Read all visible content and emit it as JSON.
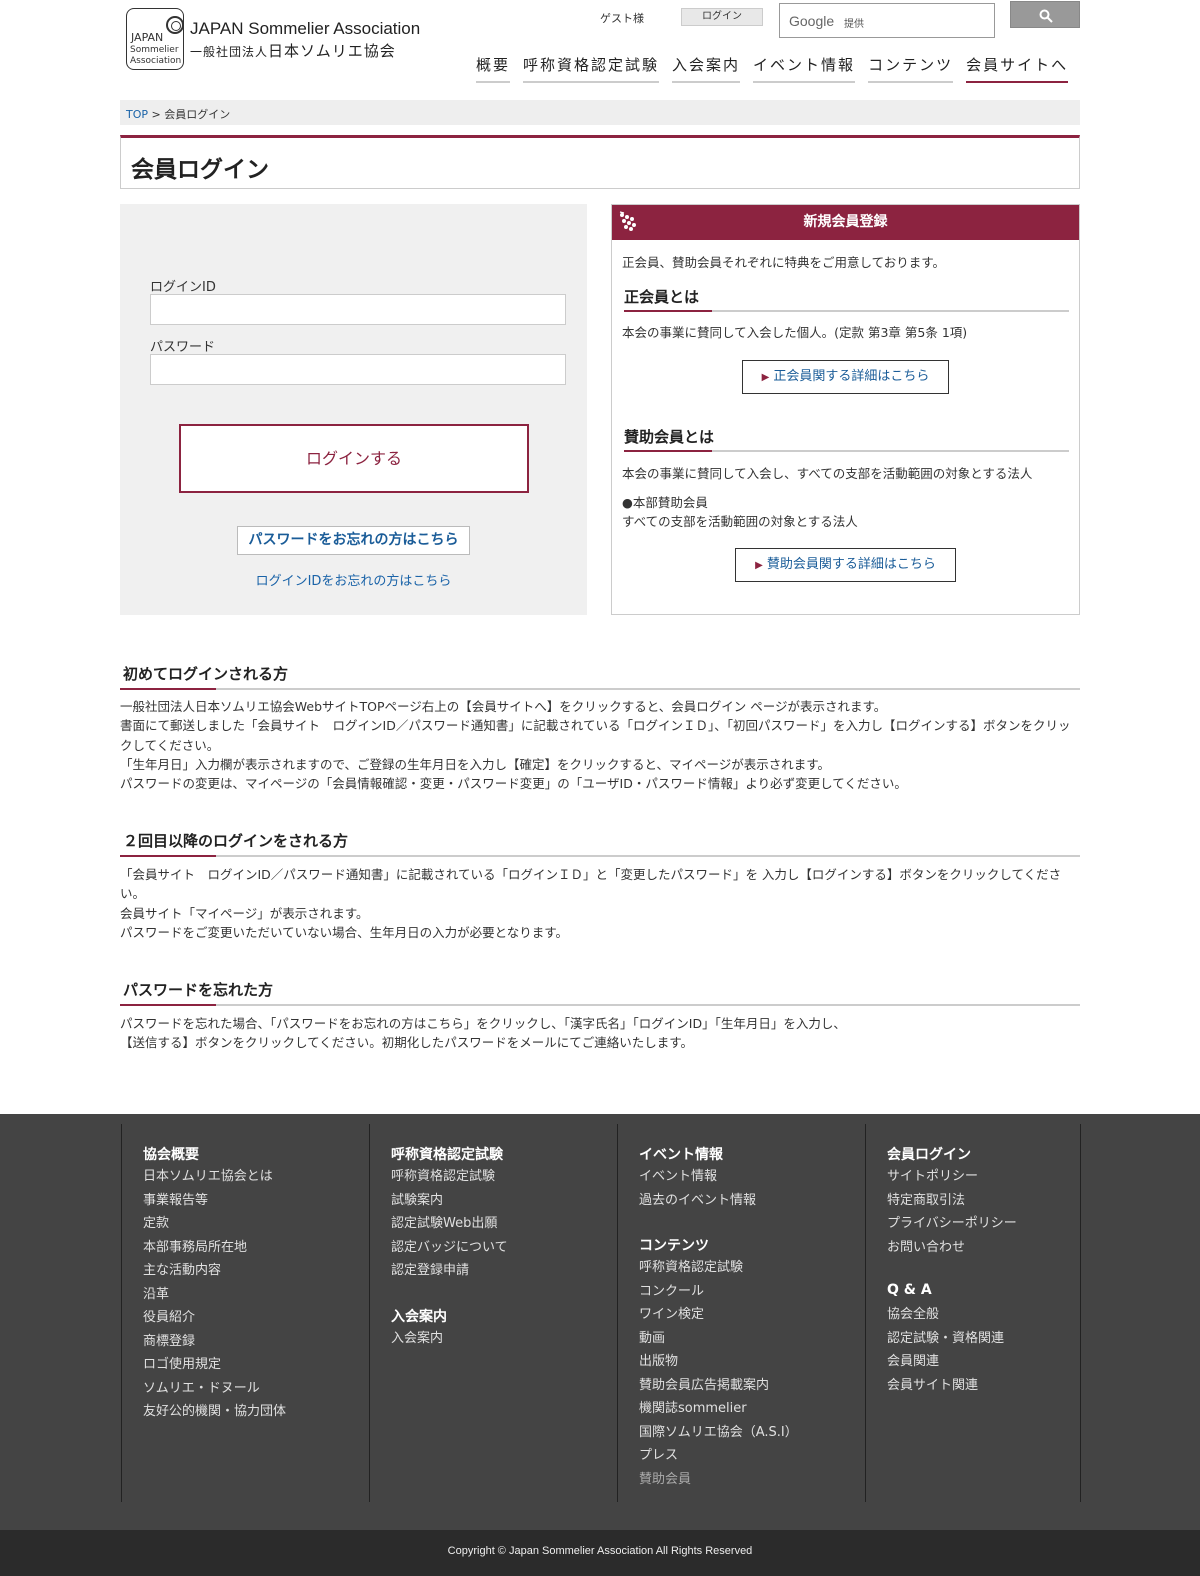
{
  "header": {
    "logo_badge_line1": "JAPAN",
    "logo_badge_line2": "Sommelier",
    "logo_badge_line3": "Association",
    "logo_en": "JAPAN Sommelier Association",
    "logo_jp_prefix": "一般社団法人",
    "logo_jp_name": "日本ソムリエ協会",
    "guest": "ゲスト様",
    "login_label": "ログイン",
    "search_brand": "Google",
    "search_provided": "提供",
    "nav": [
      "概要",
      "呼称資格認定試験",
      "入会案内",
      "イベント情報",
      "コンテンツ",
      "会員サイトへ"
    ]
  },
  "breadcrumb": {
    "top": "TOP",
    "sep": " > ",
    "current": "会員ログイン"
  },
  "page_title": "会員ログイン",
  "login": {
    "id_label": "ログインID",
    "password_label": "パスワード",
    "submit": "ログインする",
    "forgot_password": "パスワードをお忘れの方はこちら",
    "forgot_id": "ログインIDをお忘れの方はこちら"
  },
  "register": {
    "title": "新規会員登録",
    "intro": "正会員、賛助会員それぞれに特典をご用意しております。",
    "regular_heading": "正会員とは",
    "regular_text": "本会の事業に賛同して入会した個人。(定款 第3章 第5条 1項)",
    "regular_button": "正会員関する詳細はこちら",
    "supporting_heading": "賛助会員とは",
    "supporting_text": "本会の事業に賛同して入会し、すべての支部を活動範囲の対象とする法人",
    "hq_title": "●本部賛助会員",
    "hq_text": "すべての支部を活動範囲の対象とする法人",
    "supporting_button": "賛助会員関する詳細はこちら"
  },
  "sections": [
    {
      "heading": "初めてログインされる方",
      "lines": [
        "一般社団法人日本ソムリエ協会WebサイトTOPページ右上の【会員サイトへ】をクリックすると、会員ログイン ページが表示されます。",
        "書面にて郵送しました「会員サイト　ログインID／パスワード通知書」に記載されている「ログインＩＤ」、「初回パスワード」を入力し【ログインする】ボタンをクリックしてください。",
        "「生年月日」入力欄が表示されますので、ご登録の生年月日を入力し【確定】をクリックすると、マイページが表示されます。",
        "パスワードの変更は、マイページの「会員情報確認・変更・パスワード変更」の「ユーザID・パスワード情報」より必ず変更してください。"
      ]
    },
    {
      "heading": "２回目以降のログインをされる方",
      "lines": [
        "「会員サイト　ログインID／パスワード通知書」に記載されている「ログインＩＤ」と「変更したパスワード」を 入力し【ログインする】ボタンをクリックしてください。",
        "会員サイト「マイページ」が表示されます。",
        "パスワードをご変更いただいていない場合、生年月日の入力が必要となります。"
      ]
    },
    {
      "heading": "パスワードを忘れた方",
      "lines": [
        "パスワードを忘れた場合、「パスワードをお忘れの方はこちら」をクリックし、「漢字氏名」「ログインID」「生年月日」を入力し、",
        "【送信する】ボタンをクリックしてください。初期化したパスワードをメールにてご連絡いたします。"
      ]
    }
  ],
  "footer": {
    "col1": {
      "heading": "協会概要",
      "links": [
        "日本ソムリエ協会とは",
        "事業報告等",
        "定款",
        "本部事務局所在地",
        "主な活動内容",
        "沿革",
        "役員紹介",
        "商標登録",
        "ロゴ使用規定",
        "ソムリエ・ドヌール",
        "友好公的機関・協力団体"
      ]
    },
    "col2": [
      {
        "heading": "呼称資格認定試験",
        "links": [
          "呼称資格認定試験",
          "試験案内",
          "認定試験Web出願",
          "認定バッジについて",
          "認定登録申請"
        ]
      },
      {
        "heading": "入会案内",
        "links": [
          "入会案内"
        ]
      }
    ],
    "col3": [
      {
        "heading": "イベント情報",
        "links": [
          "イベント情報",
          "過去のイベント情報"
        ]
      },
      {
        "heading": "コンテンツ",
        "links": [
          "呼称資格認定試験",
          "コンクール",
          "ワイン検定",
          "動画",
          "出版物",
          "賛助会員広告掲載案内",
          "機関誌sommelier",
          "国際ソムリエ協会（A.S.I）",
          "プレス",
          "賛助会員"
        ]
      }
    ],
    "col4": [
      {
        "heading": "会員ログイン",
        "links": [
          "サイトポリシー",
          "特定商取引法",
          "プライバシーポリシー",
          "お問い合わせ"
        ]
      },
      {
        "heading": "Q & A",
        "links": [
          "協会全般",
          "認定試験・資格関連",
          "会員関連",
          "会員サイト関連"
        ]
      }
    ],
    "copyright": "Copyright © Japan Sommelier Association All Rights Reserved"
  },
  "colors": {
    "accent": "#8c2340",
    "link": "#1a63a8",
    "footer_bg": "#444444"
  }
}
